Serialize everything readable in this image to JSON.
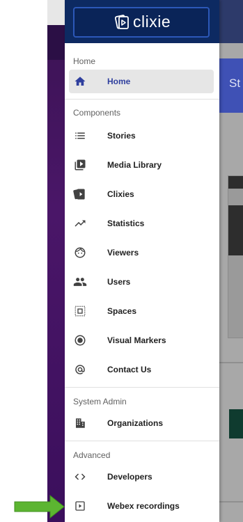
{
  "logo": {
    "text": "clixie"
  },
  "background": {
    "header_text": "St"
  },
  "sections": [
    {
      "label": "Home",
      "items": [
        {
          "label": "Home",
          "icon": "home-icon",
          "active": true
        }
      ]
    },
    {
      "label": "Components",
      "items": [
        {
          "label": "Stories",
          "icon": "list-icon"
        },
        {
          "label": "Media Library",
          "icon": "video-library-icon"
        },
        {
          "label": "Clixies",
          "icon": "clixie-cards-icon"
        },
        {
          "label": "Statistics",
          "icon": "trending-up-icon"
        },
        {
          "label": "Viewers",
          "icon": "face-icon"
        },
        {
          "label": "Users",
          "icon": "people-icon"
        },
        {
          "label": "Spaces",
          "icon": "select-area-icon"
        },
        {
          "label": "Visual Markers",
          "icon": "radio-button-icon"
        },
        {
          "label": "Contact Us",
          "icon": "at-sign-icon"
        }
      ]
    },
    {
      "label": "System Admin",
      "items": [
        {
          "label": "Organizations",
          "icon": "building-icon"
        }
      ]
    },
    {
      "label": "Advanced",
      "items": [
        {
          "label": "Developers",
          "icon": "code-icon"
        },
        {
          "label": "Webex recordings",
          "icon": "play-box-icon"
        }
      ]
    }
  ],
  "colors": {
    "accent": "#3f51b5",
    "logo_bg": "#0d2a62",
    "arrow": "#5cb531"
  }
}
